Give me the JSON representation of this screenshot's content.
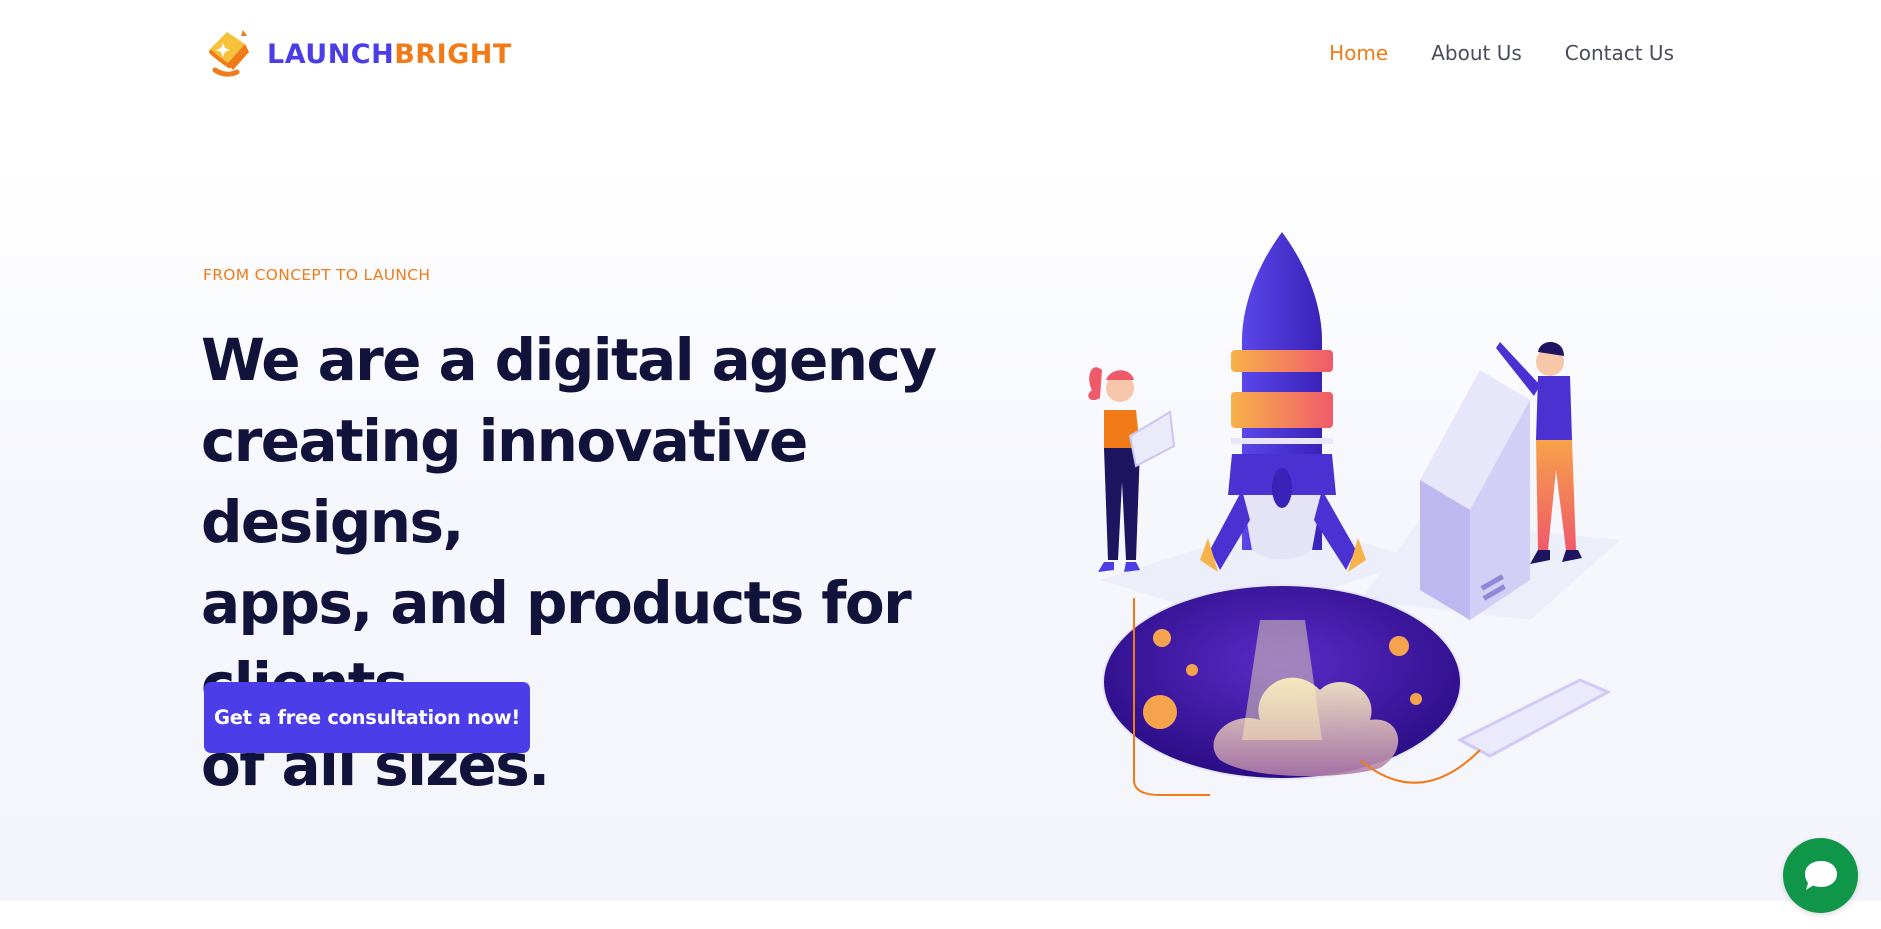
{
  "brand": {
    "name_part1": "LAUNCH",
    "name_part2": "BRIGHT",
    "primary_color": "#4b3ee6",
    "accent_color": "#f07b18"
  },
  "nav": {
    "items": [
      {
        "label": "Home",
        "active": true
      },
      {
        "label": "About Us",
        "active": false
      },
      {
        "label": "Contact Us",
        "active": false
      }
    ]
  },
  "hero": {
    "eyebrow": "FROM CONCEPT TO LAUNCH",
    "headline_lines": [
      "We are a digital agency",
      "creating innovative designs,",
      "apps, and products for clients",
      "of all sizes."
    ],
    "cta_label": "Get a free consultation now!",
    "illustration_icon": "rocket-launch-illustration"
  },
  "chat": {
    "icon": "chat-bubble-icon",
    "color": "#109648"
  }
}
